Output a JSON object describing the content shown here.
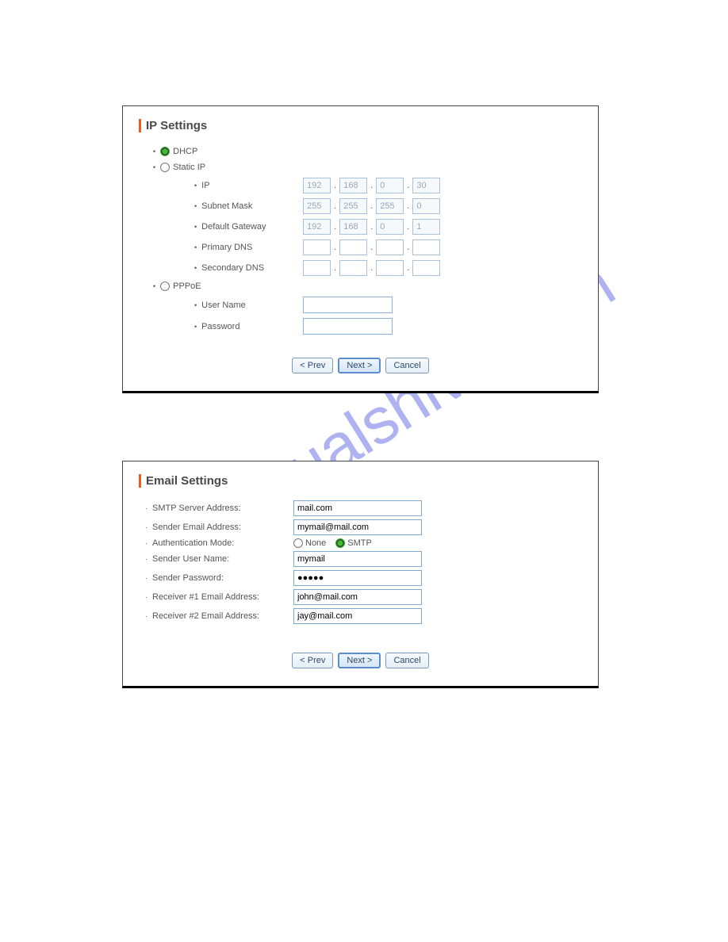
{
  "watermark": "manualshive.com",
  "ip": {
    "title": "IP Settings",
    "options": {
      "dhcp": "DHCP",
      "static": "Static IP",
      "pppoe": "PPPoE"
    },
    "selected": "dhcp",
    "fields": {
      "ip_label": "IP",
      "ip_value": [
        "192",
        "168",
        "0",
        "30"
      ],
      "subnet_label": "Subnet Mask",
      "subnet_value": [
        "255",
        "255",
        "255",
        "0"
      ],
      "gateway_label": "Default Gateway",
      "gateway_value": [
        "192",
        "168",
        "0",
        "1"
      ],
      "primary_dns_label": "Primary DNS",
      "primary_dns_value": [
        "",
        "",
        "",
        ""
      ],
      "secondary_dns_label": "Secondary DNS",
      "secondary_dns_value": [
        "",
        "",
        "",
        ""
      ]
    },
    "pppoe": {
      "user_label": "User Name",
      "user_value": "",
      "password_label": "Password",
      "password_value": ""
    }
  },
  "email": {
    "title": "Email Settings",
    "smtp_label": "SMTP Server Address:",
    "smtp_value": "mail.com",
    "sender_email_label": "Sender Email Address:",
    "sender_email_value": "mymail@mail.com",
    "auth_label": "Authentication Mode:",
    "auth_options": {
      "none": "None",
      "smtp": "SMTP"
    },
    "auth_selected": "smtp",
    "sender_user_label": "Sender User Name:",
    "sender_user_value": "mymail",
    "sender_pass_label": "Sender Password:",
    "sender_pass_value": "●●●●●",
    "recv1_label": "Receiver #1 Email Address:",
    "recv1_value": "john@mail.com",
    "recv2_label": "Receiver #2 Email Address:",
    "recv2_value": "jay@mail.com"
  },
  "buttons": {
    "prev": "< Prev",
    "next": "Next >",
    "cancel": "Cancel"
  }
}
